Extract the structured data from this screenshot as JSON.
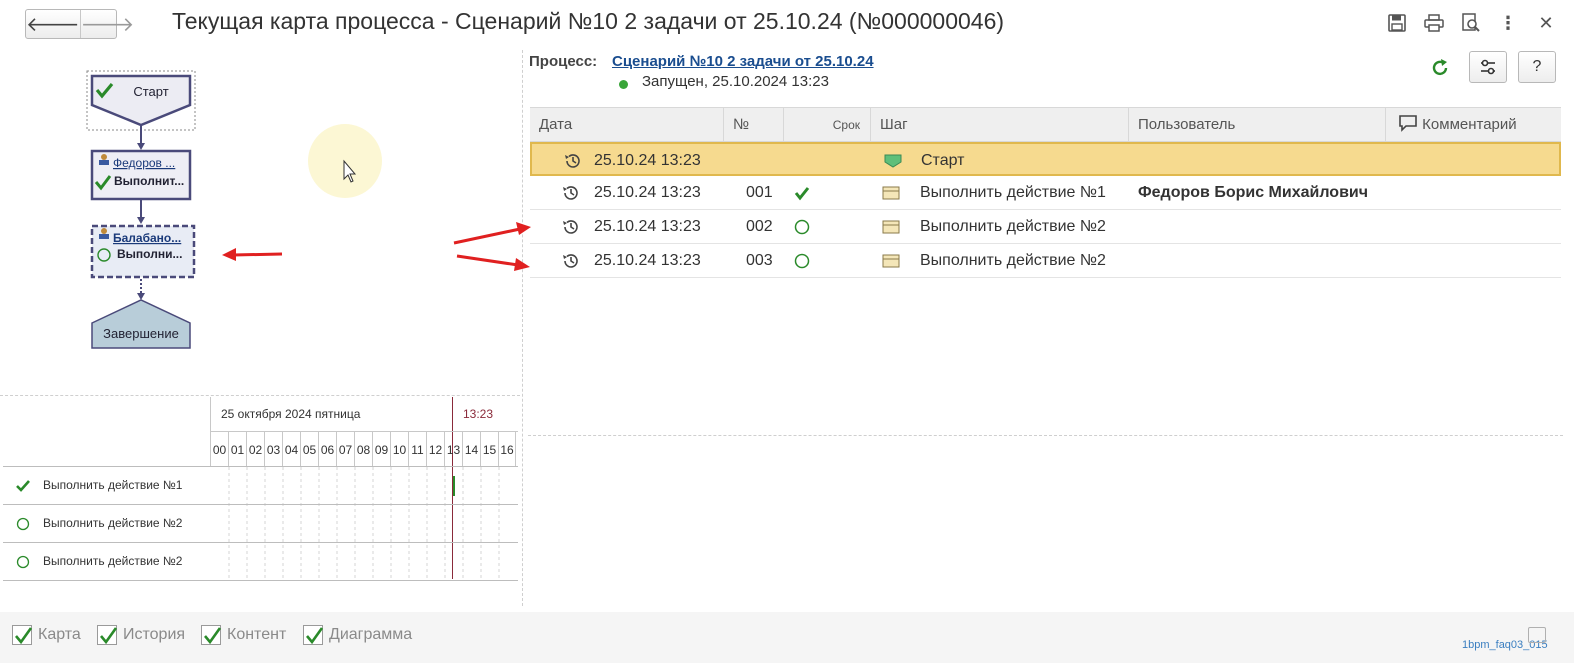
{
  "window": {
    "title": "Текущая карта процесса - Сценарий №10 2 задачи от 25.10.24 (№000000046)"
  },
  "process": {
    "label": "Процесс:",
    "name": "Сценарий №10 2 задачи от 25.10.24",
    "status": "Запущен, 25.10.2024 13:23",
    "help_label": "?"
  },
  "table": {
    "columns": {
      "date": "Дата",
      "num": "№",
      "deadline": "Срок",
      "step": "Шаг",
      "user": "Пользователь",
      "comment": "Комментарий"
    },
    "rows": [
      {
        "date": "25.10.24 13:23",
        "num": "",
        "mark": "none",
        "step": "Старт",
        "user": ""
      },
      {
        "date": "25.10.24 13:23",
        "num": "001",
        "mark": "check",
        "step": "Выполнить действие №1",
        "user": "Федоров Борис Михайлович"
      },
      {
        "date": "25.10.24 13:23",
        "num": "002",
        "mark": "circle",
        "step": "Выполнить действие №2",
        "user": ""
      },
      {
        "date": "25.10.24 13:23",
        "num": "003",
        "mark": "circle",
        "step": "Выполнить действие №2",
        "user": ""
      }
    ]
  },
  "map": {
    "start": "Старт",
    "node1_user": "Федоров ...",
    "node1_task": "Выполнит...",
    "node2_user": "Балабано...",
    "node2_task": "Выполни...",
    "end": "Завершение"
  },
  "gantt": {
    "date_header": "25 октября 2024 пятница",
    "time_marker": "13:23",
    "hours": [
      "00",
      "01",
      "02",
      "03",
      "04",
      "05",
      "06",
      "07",
      "08",
      "09",
      "10",
      "11",
      "12",
      "13",
      "14",
      "15",
      "16"
    ],
    "rows": [
      {
        "mark": "check",
        "label": "Выполнить действие №1"
      },
      {
        "mark": "circle",
        "label": "Выполнить действие №2"
      },
      {
        "mark": "circle",
        "label": "Выполнить действие №2"
      }
    ]
  },
  "footer": {
    "checkboxes": [
      "Карта",
      "История",
      "Контент",
      "Диаграмма"
    ],
    "code": "1bpm_faq03_015"
  },
  "colors": {
    "accent": "#1a4d8f",
    "selection": "#f6da8f",
    "check": "#2a8a2a",
    "arrow": "#e02020"
  }
}
